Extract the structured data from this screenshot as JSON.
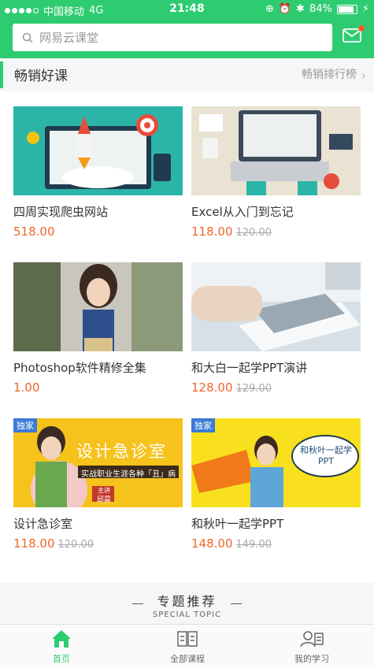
{
  "status_bar": {
    "carrier": "中国移动",
    "network": "4G",
    "time": "21:48",
    "battery": "84%",
    "battery_level": 0.84
  },
  "header": {
    "search_placeholder": "网易云课堂",
    "mail_icon": "mail-icon",
    "accent_color": "#2ecc71"
  },
  "section": {
    "title": "畅销好课",
    "more_label": "畅销排行榜"
  },
  "courses": [
    {
      "title": "四周实现爬虫网站",
      "price": "518.00",
      "original_price": ""
    },
    {
      "title": "Excel从入门到忘记",
      "price": "118.00",
      "original_price": "120.00"
    },
    {
      "title": "Photoshop软件精修全集",
      "price": "1.00",
      "original_price": ""
    },
    {
      "title": "和大白一起学PPT演讲",
      "price": "128.00",
      "original_price": "129.00"
    },
    {
      "title": "设计急诊室",
      "price": "118.00",
      "original_price": "120.00",
      "badge": "独家",
      "banner_text": "设计急诊室",
      "banner_sub": "实战职业生涯各种「丑」病",
      "host": "主讲",
      "host_name": "邱晨"
    },
    {
      "title": "和秋叶一起学PPT",
      "price": "148.00",
      "original_price": "149.00",
      "badge": "独家",
      "banner_text": "和秋叶一起学PPT"
    }
  ],
  "special_topic": {
    "title": "专题推荐",
    "subtitle": "SPECIAL TOPIC"
  },
  "tabbar": [
    {
      "label": "首页",
      "icon": "home-icon",
      "active": true
    },
    {
      "label": "全部课程",
      "icon": "courses-icon",
      "active": false
    },
    {
      "label": "我的学习",
      "icon": "my-study-icon",
      "active": false
    }
  ]
}
